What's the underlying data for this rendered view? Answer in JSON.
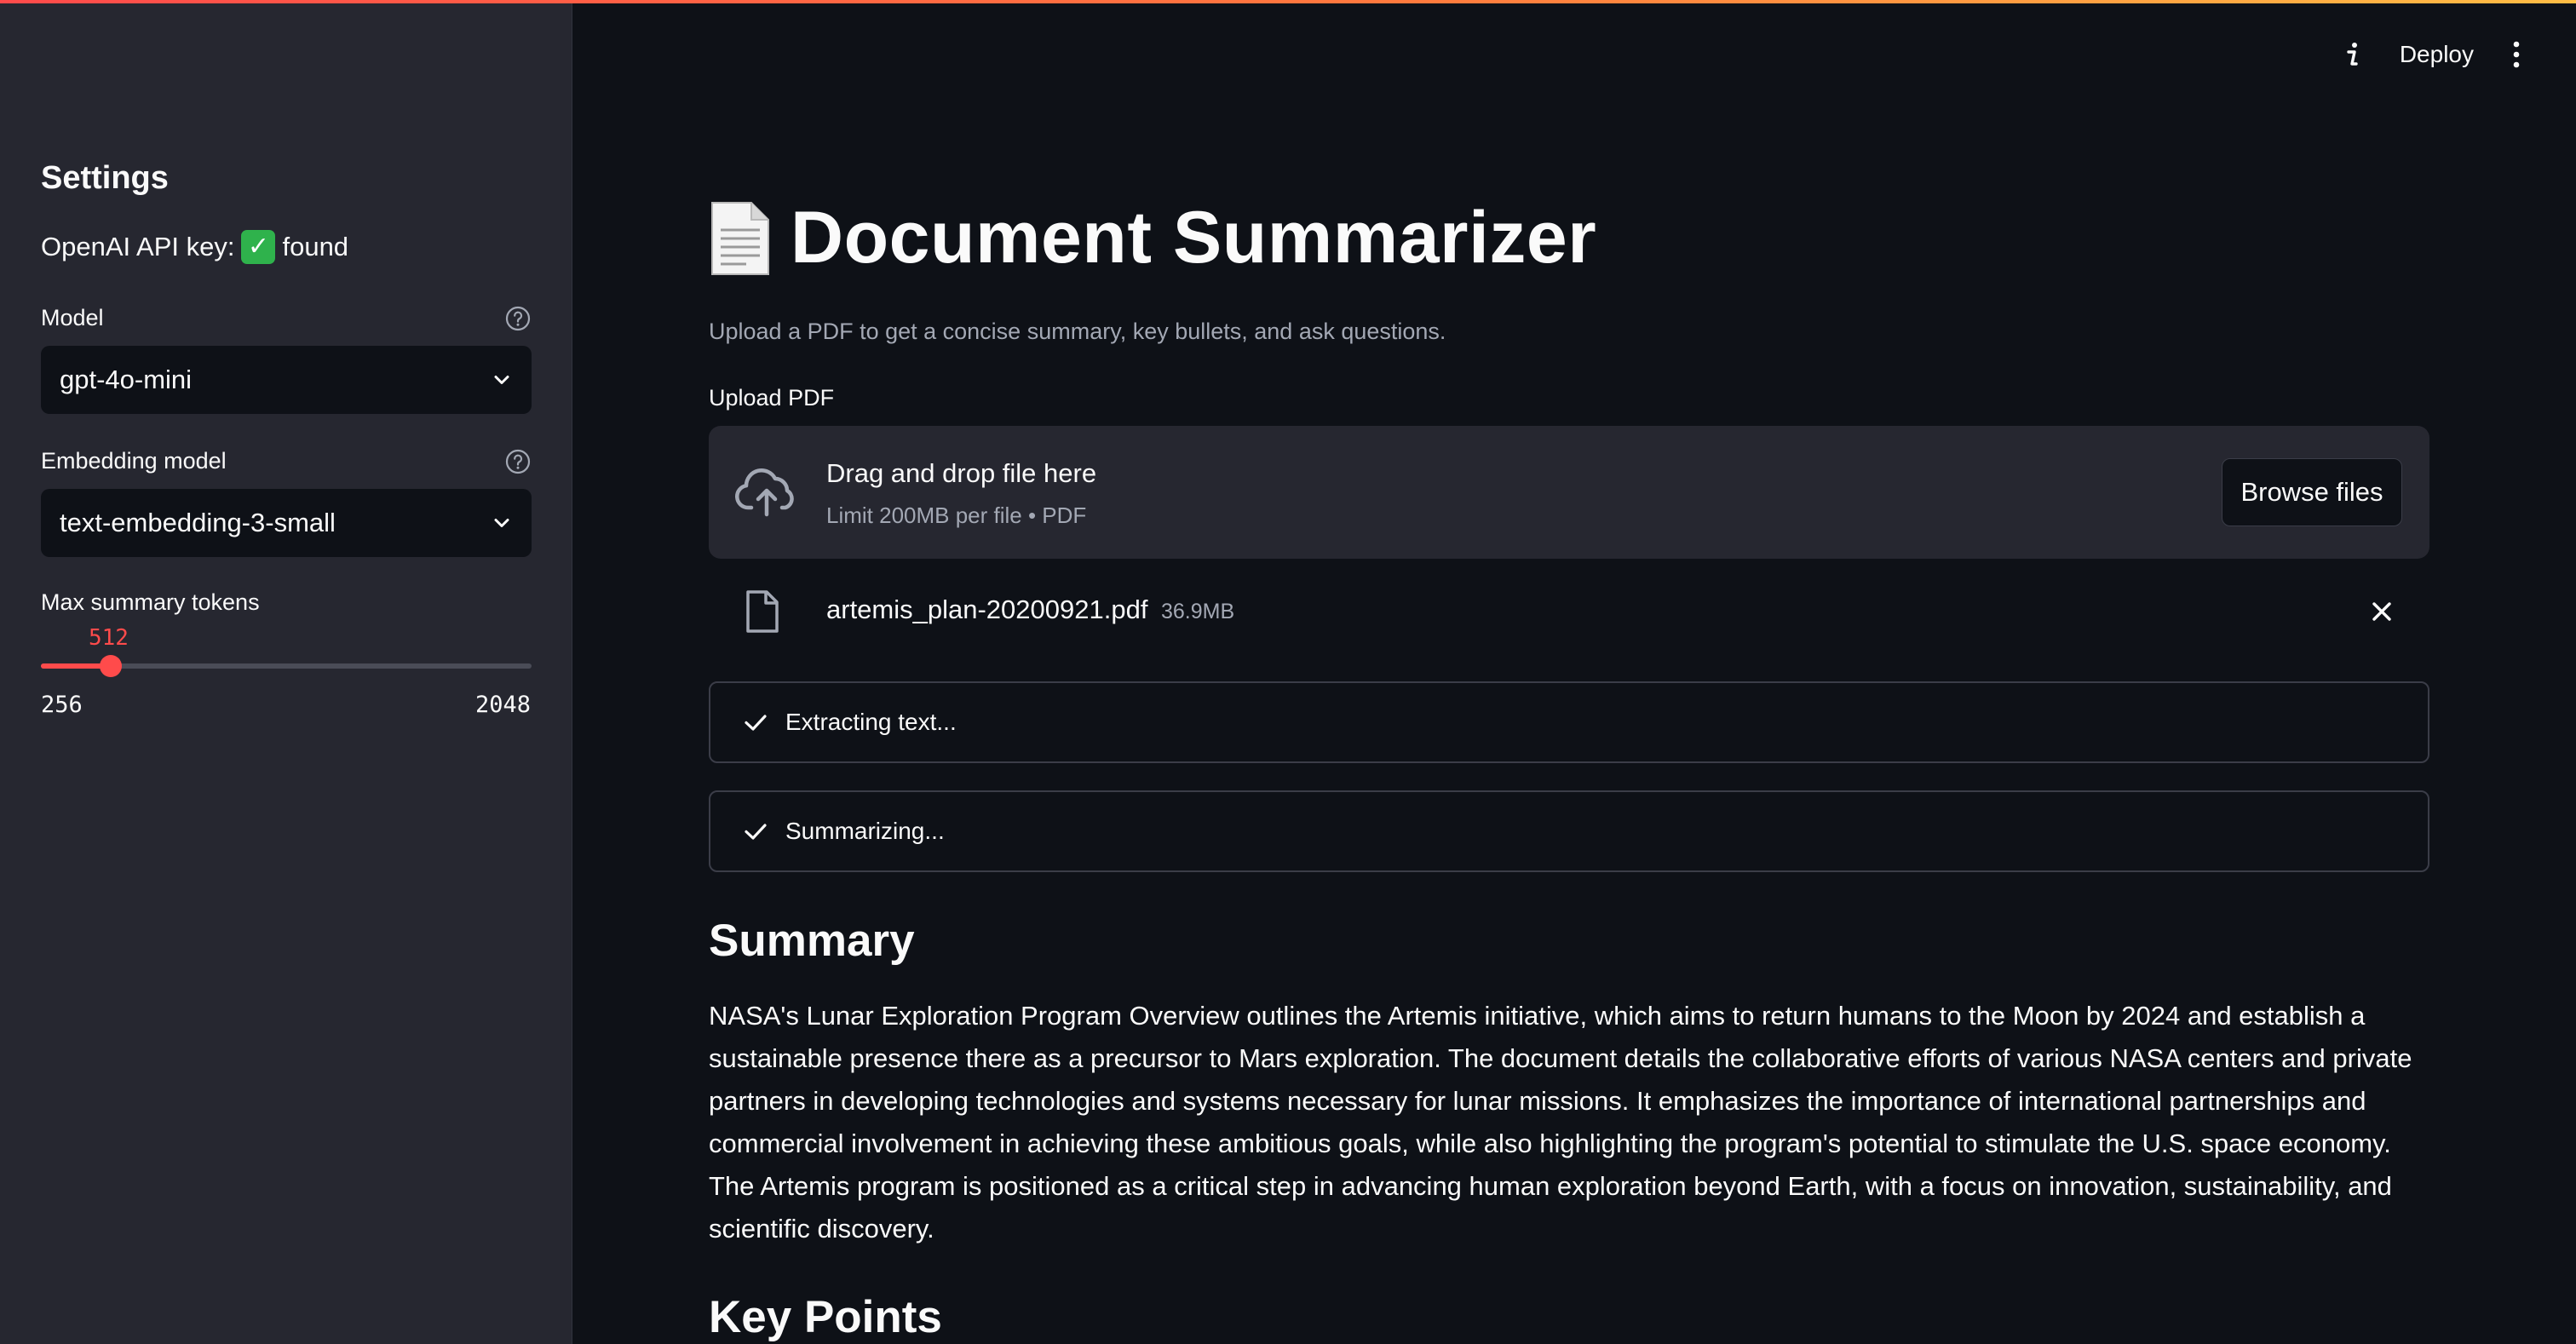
{
  "sidebar": {
    "title": "Settings",
    "api_key_label": "OpenAI API key:",
    "api_key_emoji": "✓",
    "api_key_status": "found",
    "model": {
      "label": "Model",
      "value": "gpt-4o-mini"
    },
    "embedding_model": {
      "label": "Embedding model",
      "value": "text-embedding-3-small"
    },
    "slider": {
      "label": "Max summary tokens",
      "value": "512",
      "min": "256",
      "max": "2048",
      "fill_fraction": 0.1429
    }
  },
  "toolbar": {
    "deploy_label": "Deploy",
    "info_icon": "info-icon",
    "menu_icon": "kebab-menu-icon"
  },
  "main": {
    "title": "Document Summarizer",
    "title_icon": "page-document-emoji",
    "subtitle": "Upload a PDF to get a concise summary, key bullets, and ask questions.",
    "upload_label": "Upload PDF",
    "dropzone": {
      "main_text": "Drag and drop file here",
      "sub_text": "Limit 200MB per file • PDF",
      "browse_label": "Browse files"
    },
    "file": {
      "name": "artemis_plan-20200921.pdf",
      "size": "36.9MB"
    },
    "statuses": [
      {
        "label": "Extracting text..."
      },
      {
        "label": "Summarizing..."
      }
    ],
    "summary_heading": "Summary",
    "summary_text": "NASA's Lunar Exploration Program Overview outlines the Artemis initiative, which aims to return humans to the Moon by 2024 and establish a sustainable presence there as a precursor to Mars exploration. The document details the collaborative efforts of various NASA centers and private partners in developing technologies and systems necessary for lunar missions. It emphasizes the importance of international partnerships and commercial involvement in achieving these ambitious goals, while also highlighting the program's potential to stimulate the U.S. space economy. The Artemis program is positioned as a critical step in advancing human exploration beyond Earth, with a focus on innovation, sustainability, and scientific discovery.",
    "key_points_heading": "Key Points"
  },
  "colors": {
    "accent": "#ff4b4b",
    "background": "#0e1117",
    "sidebar": "#262730",
    "muted_text": "#a3a8b4"
  }
}
